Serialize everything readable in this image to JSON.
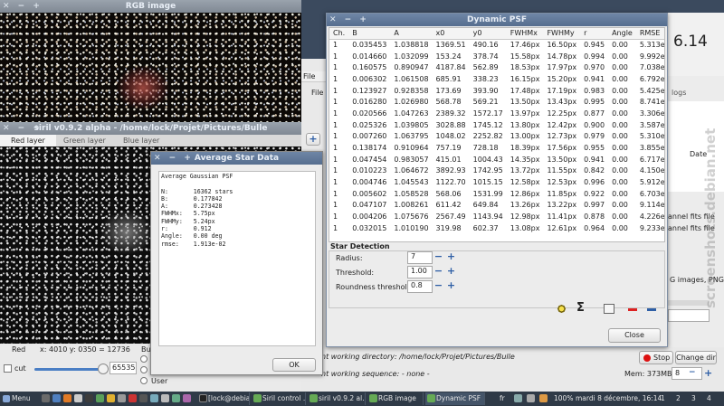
{
  "rgb_window": {
    "title": "RGB image"
  },
  "siril_window": {
    "title": "siril v0.9.2 alpha - /home/lock/Projet/Pictures/Bulle",
    "tabs": [
      "Red layer",
      "Green layer",
      "Blue layer"
    ],
    "status_layer": "Red",
    "status_coords": "x: 4010 y: 0350 = 12736",
    "status_right": "Bu",
    "cut_label": "cut",
    "cut_value": "65535",
    "user_radio": "User"
  },
  "avg_dialog": {
    "title": "Average Star Data",
    "text": "Average Gaussian PSF\n\nN:       16362 stars\nB:       0.177842\nA:       0.273428\nFWHMx:   5.75px\nFWHMy:   5.24px\nr:       0.912\nAngle:   0.00 deg\nrmse:    1.913e-02",
    "ok_label": "OK"
  },
  "psf_window": {
    "title": "Dynamic PSF",
    "columns": [
      "Ch.",
      "B",
      "A",
      "x0",
      "y0",
      "FWHMx",
      "FWHMy",
      "r",
      "Angle",
      "RMSE"
    ],
    "rows": [
      [
        "1",
        "0.035453",
        "1.038818",
        "1369.51",
        "490.16",
        "17.46px",
        "16.50px",
        "0.945",
        "0.00",
        "5.313e-02"
      ],
      [
        "1",
        "0.014660",
        "1.032099",
        "153.24",
        "378.74",
        "15.58px",
        "14.78px",
        "0.994",
        "0.00",
        "9.992e-02"
      ],
      [
        "1",
        "0.160575",
        "0.890947",
        "4187.84",
        "562.89",
        "18.53px",
        "17.97px",
        "0.970",
        "0.00",
        "7.038e-02"
      ],
      [
        "1",
        "0.006302",
        "1.061508",
        "685.91",
        "338.23",
        "16.15px",
        "15.20px",
        "0.941",
        "0.00",
        "6.792e-02"
      ],
      [
        "1",
        "0.123927",
        "0.928358",
        "173.69",
        "393.90",
        "17.48px",
        "17.19px",
        "0.983",
        "0.00",
        "5.425e-02"
      ],
      [
        "1",
        "0.016280",
        "1.026980",
        "568.78",
        "569.21",
        "13.50px",
        "13.43px",
        "0.995",
        "0.00",
        "8.741e-02"
      ],
      [
        "1",
        "0.020566",
        "1.047263",
        "2389.32",
        "1572.17",
        "13.97px",
        "12.25px",
        "0.877",
        "0.00",
        "3.306e-02"
      ],
      [
        "1",
        "0.025326",
        "1.039805",
        "3028.88",
        "1745.12",
        "13.80px",
        "12.42px",
        "0.900",
        "0.00",
        "3.587e-02"
      ],
      [
        "1",
        "0.007260",
        "1.063795",
        "1048.02",
        "2252.82",
        "13.00px",
        "12.73px",
        "0.979",
        "0.00",
        "5.310e-02"
      ],
      [
        "1",
        "0.138174",
        "0.910964",
        "757.19",
        "728.18",
        "18.39px",
        "17.56px",
        "0.955",
        "0.00",
        "3.855e-02"
      ],
      [
        "1",
        "0.047454",
        "0.983057",
        "415.01",
        "1004.43",
        "14.35px",
        "13.50px",
        "0.941",
        "0.00",
        "6.717e-02"
      ],
      [
        "1",
        "0.010223",
        "1.064672",
        "3892.93",
        "1742.95",
        "13.72px",
        "11.55px",
        "0.842",
        "0.00",
        "4.150e-02"
      ],
      [
        "1",
        "0.004746",
        "1.045543",
        "1122.70",
        "1015.15",
        "12.58px",
        "12.53px",
        "0.996",
        "0.00",
        "5.912e-02"
      ],
      [
        "1",
        "0.005602",
        "1.058528",
        "568.06",
        "1531.99",
        "12.86px",
        "11.85px",
        "0.922",
        "0.00",
        "6.703e-02"
      ],
      [
        "1",
        "0.047107",
        "1.008261",
        "611.42",
        "649.84",
        "13.26px",
        "13.22px",
        "0.997",
        "0.00",
        "9.114e-02"
      ],
      [
        "1",
        "0.004206",
        "1.075676",
        "2567.49",
        "1143.94",
        "12.98px",
        "11.41px",
        "0.878",
        "0.00",
        "4.226e-02"
      ],
      [
        "1",
        "0.032015",
        "1.010190",
        "319.98",
        "602.37",
        "13.08px",
        "12.61px",
        "0.964",
        "0.00",
        "9.233e-02"
      ]
    ],
    "star_detection_label": "Star Detection",
    "radius_label": "Radius:",
    "radius_value": "7",
    "threshold_label": "Threshold:",
    "threshold_value": "1.00",
    "roundness_label": "Roundness threshold:",
    "roundness_value": "0.8",
    "sigma_glyph": "Σ",
    "close_label": "Close"
  },
  "back_window": {
    "file_menu": "File",
    "file_label": "File",
    "plus": "+",
    "version_text": "6.14",
    "logs_label": "logs",
    "date_label": "Date",
    "fits1": "annel fits file",
    "fits2": "annel fits file",
    "png_label": "G images, PNG",
    "working_dir": "nt working directory: /home/lock/Projet/Pictures/Bulle",
    "working_seq": "nt working sequence: - none -",
    "stop_label": "Stop",
    "change_dir_label": "Change dir",
    "mem_label": "Mem: 373MB",
    "threads_value": "8",
    "watermark": "screenshots.debian.net"
  },
  "taskbar": {
    "menu": "Menu",
    "tasks": [
      "[lock@debia...",
      "Siril control ...",
      "siril v0.9.2 al...",
      "RGB image",
      "Dynamic PSF"
    ],
    "locale": "fr",
    "battery": "100%",
    "clock": "mardi  8 décembre, 16:14",
    "workspaces": [
      "1",
      "2",
      "3",
      "4"
    ]
  }
}
